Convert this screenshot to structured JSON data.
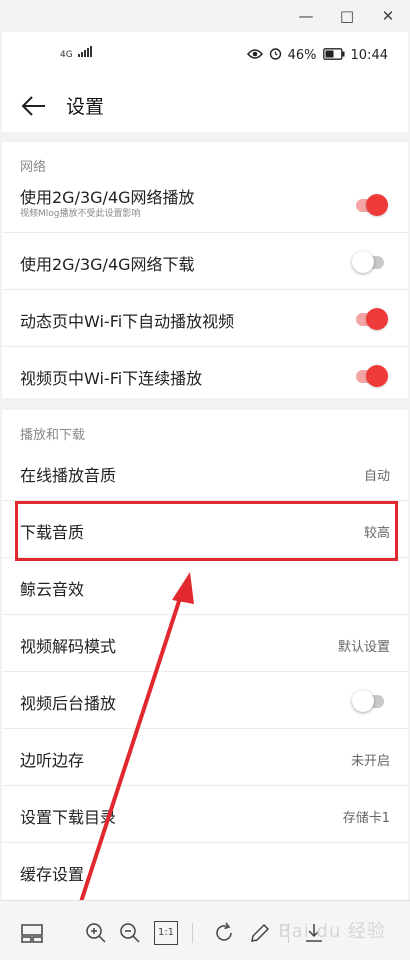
{
  "status_bar": {
    "network": "4G",
    "battery": "46%",
    "time": "10:44"
  },
  "header": {
    "title": "设置"
  },
  "sections": {
    "network": {
      "title": "网络",
      "items": [
        {
          "label": "使用2G/3G/4G网络播放",
          "sublabel": "视频Mlog播放不受此设置影响",
          "toggle": true
        },
        {
          "label": "使用2G/3G/4G网络下载",
          "toggle": false
        },
        {
          "label": "动态页中Wi-Fi下自动播放视频",
          "toggle": true
        },
        {
          "label": "视频页中Wi-Fi下连续播放",
          "toggle": true
        }
      ]
    },
    "playback": {
      "title": "播放和下载",
      "items": [
        {
          "label": "在线播放音质",
          "value": "自动"
        },
        {
          "label": "下载音质",
          "value": "较高"
        },
        {
          "label": "鲸云音效"
        },
        {
          "label": "视频解码模式",
          "value": "默认设置"
        },
        {
          "label": "视频后台播放",
          "toggle": false
        },
        {
          "label": "边听边存",
          "value": "未开启"
        },
        {
          "label": "设置下载目录",
          "value": "存储卡1"
        },
        {
          "label": "缓存设置"
        }
      ]
    }
  },
  "viewer_toolbar": {
    "actual_size_label": "1:1",
    "watermark": "Bai du 经验"
  },
  "colors": {
    "accent": "#ef3a3a",
    "annotation": "#e0282e"
  }
}
